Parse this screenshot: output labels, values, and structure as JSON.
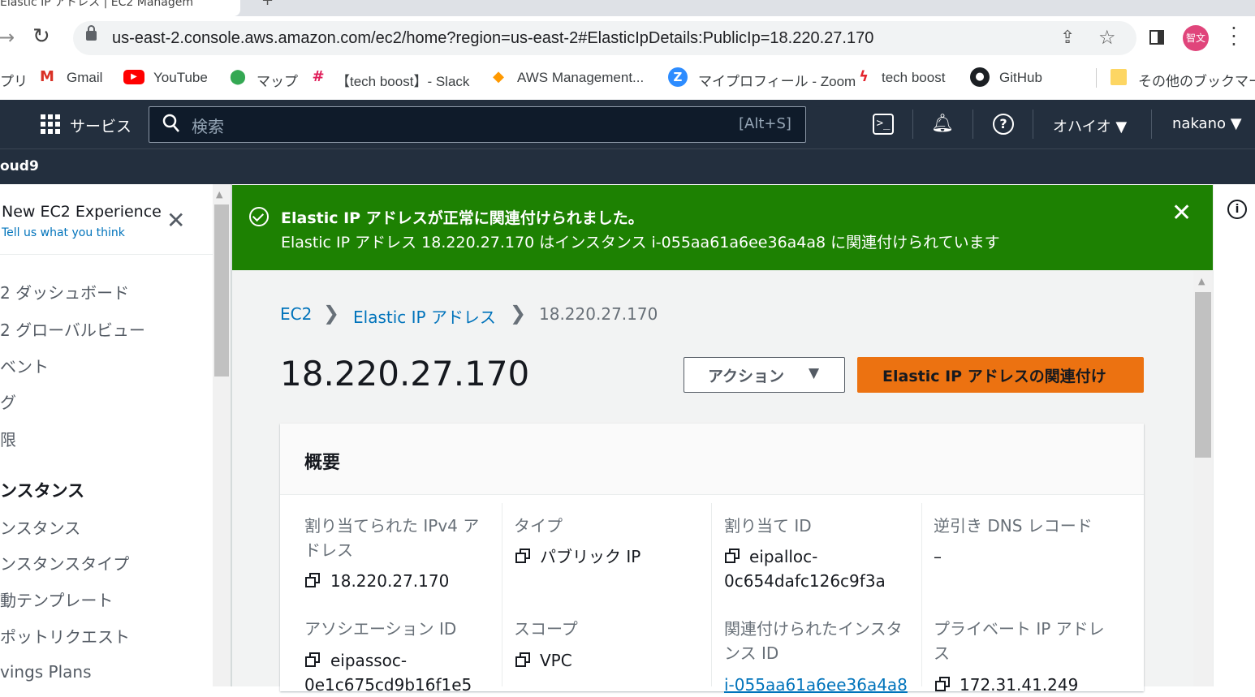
{
  "browser": {
    "tab_title": "Elastic IP アドレス | EC2 Managem",
    "url": "us-east-2.console.aws.amazon.com/ec2/home?region=us-east-2#ElasticIpDetails:PublicIp=18.220.27.170",
    "profile_label": "智文",
    "bookmarks": [
      "プリ",
      "Gmail",
      "YouTube",
      "マップ",
      "【tech boost】- Slack",
      "AWS Management...",
      "マイプロフィール - Zoom",
      "tech boost",
      "GitHub",
      "その他のブックマーク"
    ]
  },
  "aws_header": {
    "services_label": "サービス",
    "search_placeholder": "検索",
    "search_shortcut": "[Alt+S]",
    "region": "オハイオ ▼",
    "user": "nakano ▼",
    "favorite": "oud9"
  },
  "sidenav": {
    "promo_title": "New EC2 Experience",
    "promo_link": "Tell us what you think",
    "items": [
      "2 ダッシュボード",
      "2 グローバルビュー",
      "ベント",
      "グ",
      "限"
    ],
    "section": "ンスタンス",
    "section_items": [
      "ンスタンス",
      "ンスタンスタイプ",
      "動テンプレート",
      "ポットリクエスト",
      "vings Plans"
    ]
  },
  "flash": {
    "title": "Elastic IP アドレスが正常に関連付けられました。",
    "message": "Elastic IP アドレス 18.220.27.170 はインスタンス i-055aa61a6ee36a4a8 に関連付けられています"
  },
  "breadcrumb": {
    "root": "EC2",
    "parent": "Elastic IP アドレス",
    "current": "18.220.27.170",
    "separator": "❯"
  },
  "page": {
    "title": "18.220.27.170",
    "actions_label": "アクション",
    "actions_caret": "▼",
    "associate_label": "Elastic IP アドレスの関連付け"
  },
  "summary": {
    "title": "概要",
    "fields": {
      "ipv4_label": "割り当てられた IPv4 アドレス",
      "ipv4_value": "18.220.27.170",
      "type_label": "タイプ",
      "type_value": "パブリック IP",
      "alloc_label": "割り当て ID",
      "alloc_value_1": "eipalloc-",
      "alloc_value_2": "0c654dafc126c9f3a",
      "rdns_label": "逆引き DNS レコード",
      "rdns_value": "–",
      "assoc_label": "アソシエーション ID",
      "assoc_value_1": "eipassoc-",
      "assoc_value_2": "0e1c675cd9b16f1e5",
      "scope_label": "スコープ",
      "scope_value": "VPC",
      "instance_label": "関連付けられたインスタンス ID",
      "instance_value": "i-055aa61a6ee36a4a8",
      "private_ip_label": "プライベート IP アドレス",
      "private_ip_value": "172.31.41.249"
    }
  },
  "colors": {
    "aws_nav": "#232f3e",
    "flash_success": "#1d8102",
    "primary_button": "#ec7211",
    "link": "#0073bb"
  }
}
